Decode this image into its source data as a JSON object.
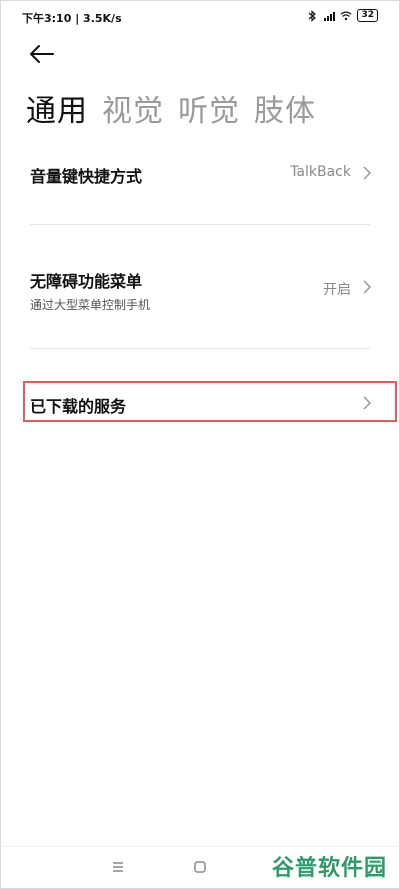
{
  "status_bar": {
    "time_speed": "下午3:10 | 3.5K/s",
    "battery": "32"
  },
  "tabs": [
    {
      "label": "通用",
      "active": true
    },
    {
      "label": "视觉",
      "active": false
    },
    {
      "label": "听觉",
      "active": false
    },
    {
      "label": "肢体",
      "active": false
    }
  ],
  "rows": [
    {
      "title": "音量键快捷方式",
      "value": "TalkBack"
    },
    {
      "title": "无障碍功能菜单",
      "subtitle": "通过大型菜单控制手机",
      "value": "开启"
    },
    {
      "title": "已下载的服务"
    }
  ],
  "watermark": "谷普软件园",
  "colors": {
    "highlight": "#e55a5a",
    "watermark": "#2e9b6a"
  }
}
